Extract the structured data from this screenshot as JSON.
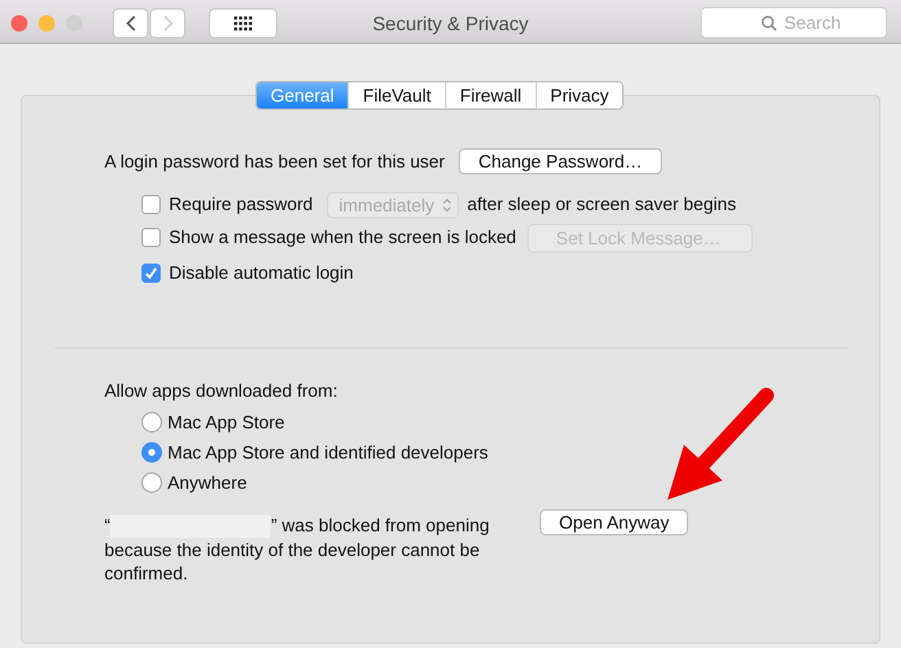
{
  "window": {
    "title": "Security & Privacy",
    "traffic_lights": [
      {
        "color": "#fc605c"
      },
      {
        "color": "#fdbc40"
      },
      {
        "color": "#cfcfcf"
      }
    ],
    "nav": [
      {
        "kind": "back",
        "disabled": false
      },
      {
        "kind": "forward",
        "disabled": true
      }
    ],
    "search": {
      "placeholder": "Search"
    }
  },
  "tabs": [
    {
      "label": "General",
      "selected": true
    },
    {
      "label": "FileVault",
      "selected": false
    },
    {
      "label": "Firewall",
      "selected": false
    },
    {
      "label": "Privacy",
      "selected": false
    }
  ],
  "login": {
    "text": "A login password has been set for this user",
    "button": "Change Password…"
  },
  "options": [
    {
      "kind": "popup",
      "label": "Require password",
      "checked": false,
      "popup": {
        "value": "immediately",
        "disabled": true
      },
      "after": "after sleep or screen saver begins"
    },
    {
      "kind": "button",
      "label": "Show a message when the screen is locked",
      "checked": false,
      "button": {
        "label": "Set Lock Message…",
        "disabled": true
      }
    },
    {
      "kind": "plain",
      "label": "Disable automatic login",
      "checked": true
    }
  ],
  "allow": {
    "label": "Allow apps downloaded from:",
    "choices": [
      {
        "label": "Mac App Store",
        "selected": false
      },
      {
        "label": "Mac App Store and identified developers",
        "selected": true
      },
      {
        "label": "Anywhere",
        "selected": false
      }
    ]
  },
  "blocked": {
    "quote_open": "“",
    "message": "” was blocked from opening because the identity of the developer cannot be confirmed.",
    "button": "Open Anyway"
  }
}
